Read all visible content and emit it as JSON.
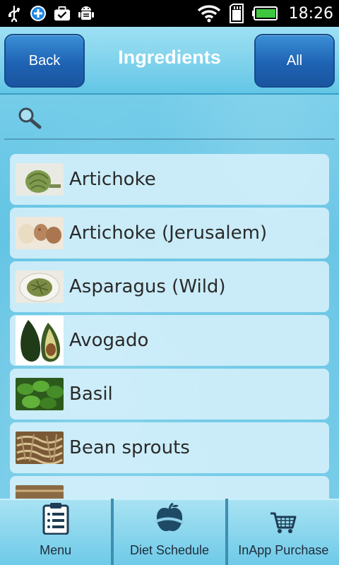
{
  "status_bar": {
    "time": "18:26",
    "icons": [
      "usb-icon",
      "plus-icon",
      "briefcase-check-icon",
      "android-debug-icon",
      "wifi-icon",
      "sd-card-icon",
      "battery-icon"
    ],
    "battery_color": "#3ec63e"
  },
  "header": {
    "back_label": "Back",
    "title": "Ingredients",
    "all_label": "All"
  },
  "search": {
    "placeholder": "",
    "value": ""
  },
  "ingredients": [
    {
      "label": "Artichoke",
      "image": "artichoke"
    },
    {
      "label": "Artichoke (Jerusalem)",
      "image": "jerusalem-artichoke"
    },
    {
      "label": "Asparagus (Wild)",
      "image": "wild-asparagus"
    },
    {
      "label": "Avogado",
      "image": "avocado"
    },
    {
      "label": "Basil",
      "image": "basil"
    },
    {
      "label": "Bean sprouts",
      "image": "bean-sprouts"
    },
    {
      "label": "",
      "image": "partial"
    }
  ],
  "tabs": [
    {
      "label": "Menu",
      "icon": "clipboard-list-icon"
    },
    {
      "label": "Diet Schedule",
      "icon": "apple-measuring-tape-icon"
    },
    {
      "label": "InApp Purchase",
      "icon": "shopping-cart-icon"
    }
  ],
  "colors": {
    "button_blue": "#1f63b4",
    "background": "#6cc9e6"
  }
}
